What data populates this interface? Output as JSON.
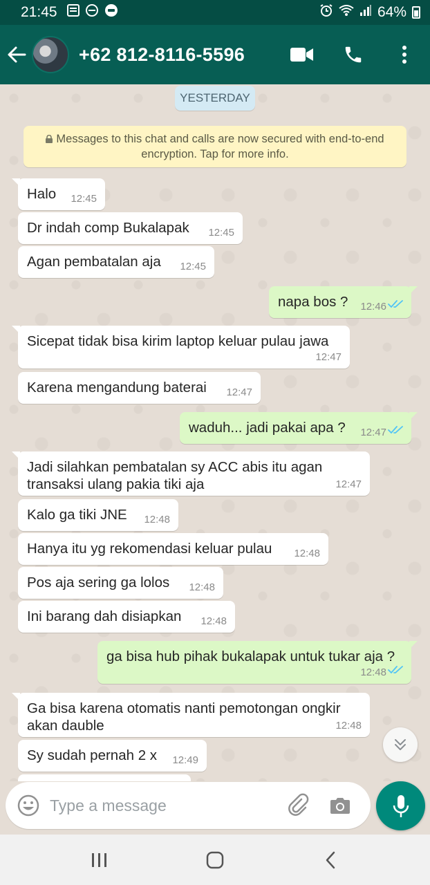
{
  "status_bar": {
    "time": "21:45",
    "battery": "64%",
    "icons": [
      "news-icon",
      "minus-circle-icon",
      "chat-bubble-icon",
      "alarm-icon",
      "wifi-icon",
      "signal-icon",
      "battery-icon"
    ]
  },
  "header": {
    "contact": "+62 812-8116-5596",
    "icons": [
      "back-arrow-icon",
      "video-call-icon",
      "phone-icon",
      "more-vert-icon"
    ]
  },
  "chat": {
    "date_label": "YESTERDAY",
    "encryption_notice": "Messages to this chat and calls are now secured with end-to-end encryption. Tap for more info.",
    "messages": [
      {
        "dir": "in",
        "text": "Halo",
        "time": "12:45"
      },
      {
        "dir": "in",
        "text": "Dr indah comp Bukalapak",
        "time": "12:45"
      },
      {
        "dir": "in",
        "text": "Agan pembatalan aja",
        "time": "12:45"
      },
      {
        "dir": "out",
        "text": "napa bos ?",
        "time": "12:46",
        "status": "read"
      },
      {
        "dir": "in",
        "text": "Sicepat tidak bisa kirim laptop keluar pulau jawa",
        "time": "12:47"
      },
      {
        "dir": "in",
        "text": "Karena mengandung baterai",
        "time": "12:47"
      },
      {
        "dir": "out",
        "text": "waduh... jadi pakai apa ?",
        "time": "12:47",
        "status": "read"
      },
      {
        "dir": "in",
        "text": "Jadi silahkan pembatalan sy ACC abis itu agan transaksi ulang pakia tiki aja",
        "time": "12:47"
      },
      {
        "dir": "in",
        "text": "Kalo ga tiki JNE",
        "time": "12:48"
      },
      {
        "dir": "in",
        "text": "Hanya itu yg rekomendasi keluar pulau",
        "time": "12:48"
      },
      {
        "dir": "in",
        "text": "Pos aja sering ga lolos",
        "time": "12:48"
      },
      {
        "dir": "in",
        "text": "Ini barang dah disiapkan",
        "time": "12:48"
      },
      {
        "dir": "out",
        "text": "ga bisa hub pihak bukalapak untuk tukar aja ?",
        "time": "12:48",
        "status": "read"
      },
      {
        "dir": "in",
        "text": "Ga bisa karena otomatis nanti pemotongan ongkir akan dauble",
        "time": "12:48"
      },
      {
        "dir": "in",
        "text": "Sy sudah pernah 2 x",
        "time": "12:49"
      }
    ]
  },
  "composer": {
    "placeholder": "Type a message",
    "icons": [
      "emoji-icon",
      "attach-icon",
      "camera-icon",
      "mic-icon"
    ]
  },
  "colors": {
    "header": "#075e54",
    "status_bar": "#054d44",
    "outgoing_bubble": "#dcf8c6",
    "incoming_bubble": "#ffffff",
    "read_ticks": "#4fc3f7",
    "mic_button": "#00897b"
  }
}
